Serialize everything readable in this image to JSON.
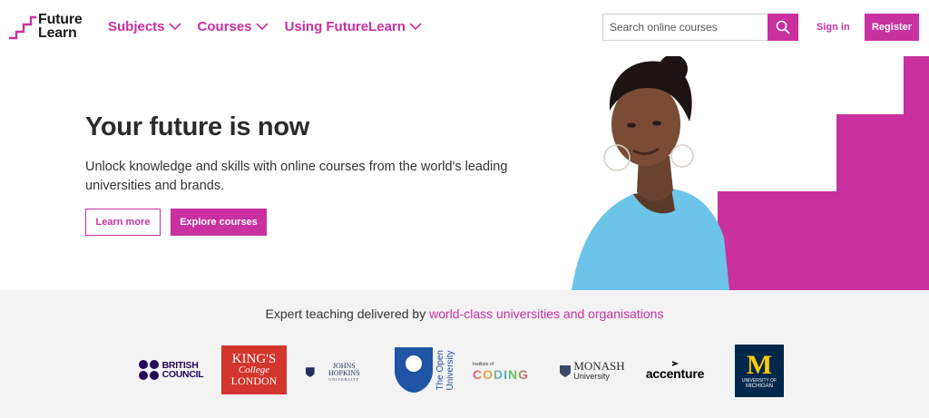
{
  "brand": {
    "line1": "Future",
    "line2": "Learn",
    "accent_color": "#c8319f"
  },
  "nav": {
    "items": [
      {
        "label": "Subjects"
      },
      {
        "label": "Courses"
      },
      {
        "label": "Using FutureLearn"
      }
    ]
  },
  "search": {
    "placeholder": "Search online courses",
    "icon": "search-icon"
  },
  "auth": {
    "signin_label": "Sign in",
    "register_label": "Register"
  },
  "hero": {
    "title": "Your future is now",
    "text": "Unlock knowledge and skills with online courses from the world's leading universities and brands.",
    "learn_more_label": "Learn more",
    "explore_label": "Explore courses"
  },
  "partners": {
    "heading_prefix": "Expert teaching delivered by ",
    "heading_link": "world-class universities and organisations",
    "logos": {
      "british_council": {
        "line1": "BRITISH",
        "line2": "COUNCIL"
      },
      "kings": {
        "line1": "KING'S",
        "line2": "College",
        "line3": "LONDON"
      },
      "johns_hopkins": {
        "line1": "JOHNS HOPKINS",
        "line2": "UNIVERSITY"
      },
      "open_university": {
        "line1": "The Open",
        "line2": "University"
      },
      "institute_of_coding": {
        "line1": "Institute of",
        "line2": "CODING"
      },
      "monash": {
        "line1": "MONASH",
        "line2": "University"
      },
      "accenture": {
        "text": "accenture"
      },
      "michigan": {
        "line1": "M",
        "line2": "UNIVERSITY OF",
        "line3": "MICHIGAN"
      }
    }
  }
}
